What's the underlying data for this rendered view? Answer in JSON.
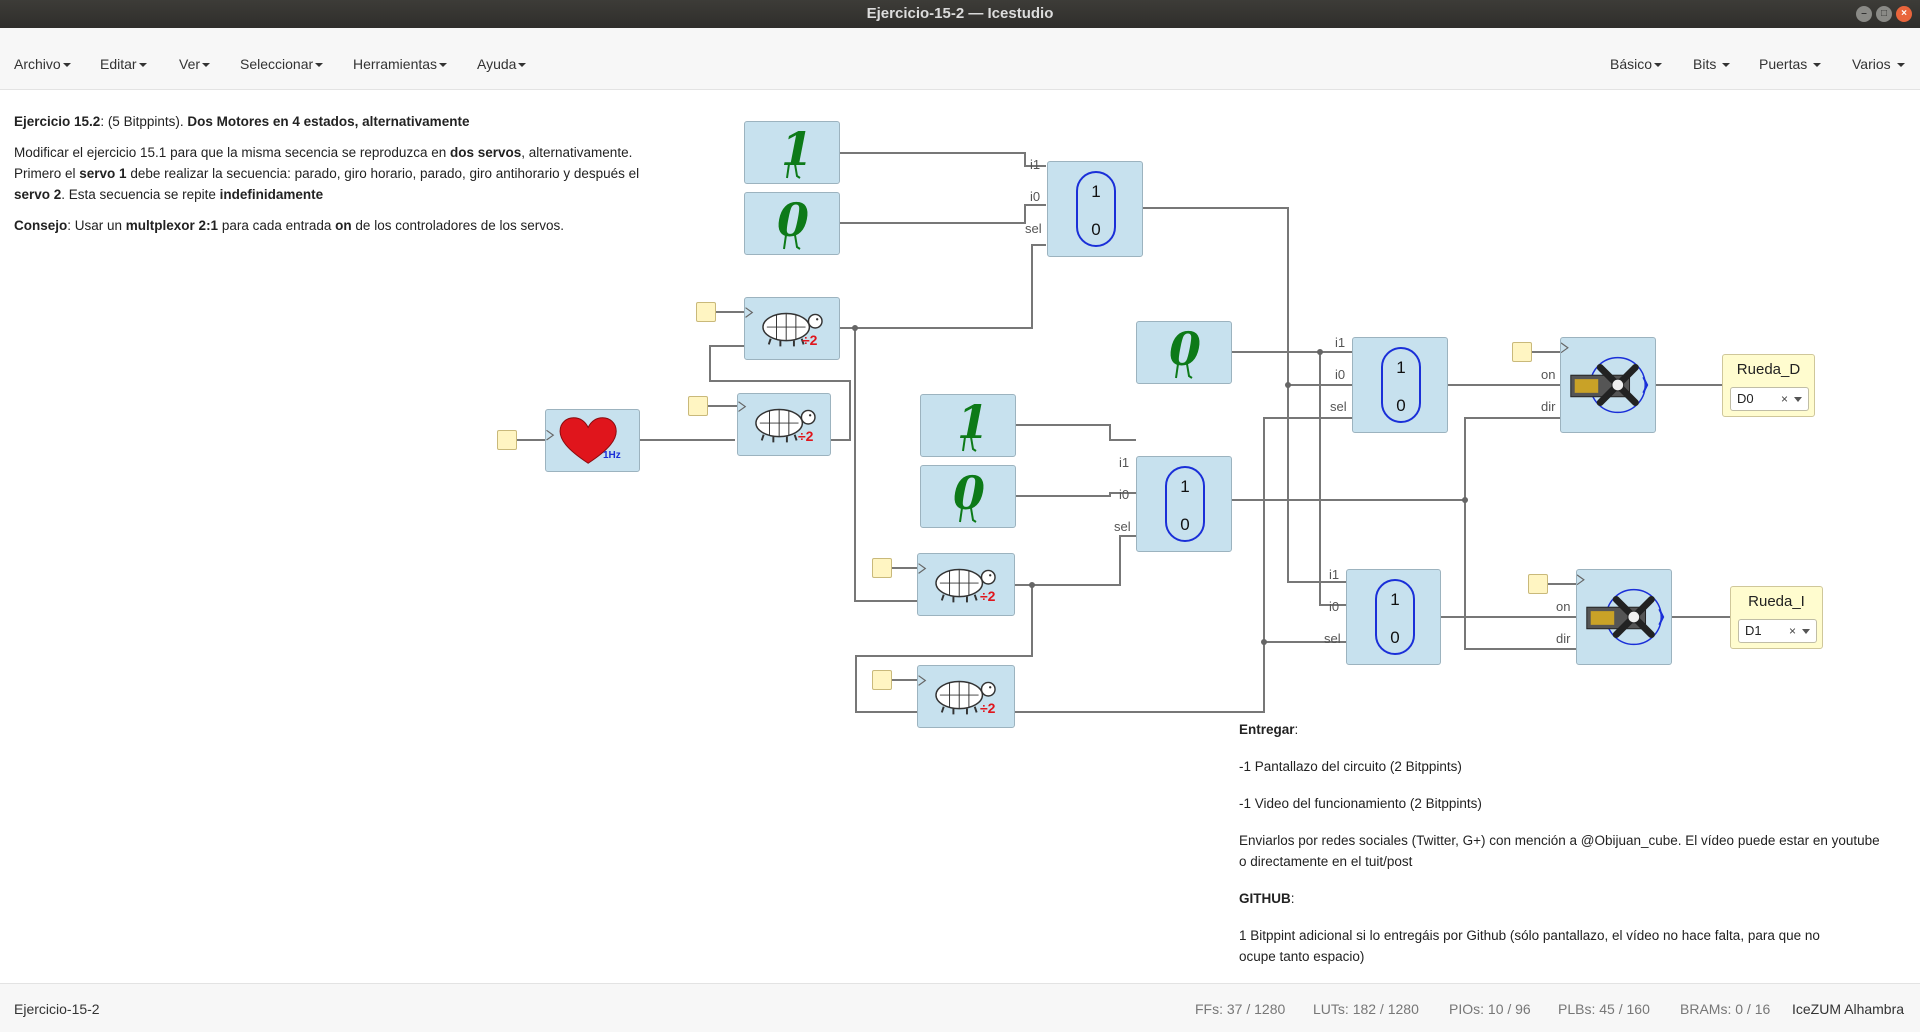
{
  "window": {
    "title": "Ejercicio-15-2 — Icestudio"
  },
  "menubar": {
    "left": [
      "Archivo",
      "Editar",
      "Ver",
      "Seleccionar",
      "Herramientas",
      "Ayuda"
    ],
    "right": [
      "Básico",
      "Bits",
      "Puertas",
      "Varios"
    ]
  },
  "description": {
    "heading_bold": "Ejercicio 15.2",
    "heading_mid": ": (5 Bitppints). ",
    "heading_bold2": "Dos Motores en 4 estados, alternativamente",
    "p1_a": "Modificar el ejercicio 15.1 para que la misma secencia se reproduzca en ",
    "p1_b": "dos servos",
    "p1_c": ", alternativamente.",
    "p2_a": "Primero el ",
    "p2_b": "servo 1",
    "p2_c": " debe realizar la secuencia: parado, giro horario, parado, giro antihorario y después el",
    "p3_a": "servo 2",
    "p3_b": ". Esta secuencia se repite ",
    "p3_c": "indefinidamente",
    "p4_a": "Consejo",
    "p4_b": ": Usar un ",
    "p4_c": "multplexor 2:1",
    "p4_d": " para cada entrada ",
    "p4_e": "on",
    "p4_f": " de los controladores de los servos."
  },
  "deliver": {
    "title": "Entregar",
    "title_colon": ":",
    "item1": "-1 Pantallazo del circuito (2 Bitppints)",
    "item2": "-1 Video del funcionamiento (2 Bitppints)",
    "send1": "Enviarlos por redes sociales (Twitter, G+) con mención a @Obijuan_cube. El vídeo puede estar en youtube",
    "send2": "o directamente en el tuit/post",
    "github": "GITHUB",
    "github_colon": ":",
    "gh1": "1 Bitppint adicional si lo entregáis por Github (sólo pantallazo, el vídeo no hace falta, para que no",
    "gh2": "ocupe tanto espacio)"
  },
  "blocks": {
    "heart_label": "1Hz",
    "div_label": "÷2",
    "const_one": "1",
    "const_zero": "0",
    "mux_top": "1",
    "mux_bottom": "0",
    "pins": {
      "i1": "i1",
      "i0": "i0",
      "sel": "sel",
      "on": "on",
      "dir": "dir"
    }
  },
  "outputs": [
    {
      "name": "Rueda_D",
      "value": "D0"
    },
    {
      "name": "Rueda_I",
      "value": "D1"
    }
  ],
  "status": {
    "file": "Ejercicio-15-2",
    "ffs_label": "FFs:",
    "ffs": "37 / 1280",
    "luts_label": "LUTs:",
    "luts": "182 / 1280",
    "pios_label": "PIOs:",
    "pios": "10 / 96",
    "plbs_label": "PLBs:",
    "plbs": "45 / 160",
    "brams_label": "BRAMs:",
    "brams": "0 / 16",
    "board": "IceZUM Alhambra"
  },
  "colors": {
    "block_bg": "#c7e1ee",
    "wire": "#777777",
    "mux_outline": "#1a2fd8",
    "const_green": "#0d7a18",
    "heart_red": "#e0151c"
  }
}
